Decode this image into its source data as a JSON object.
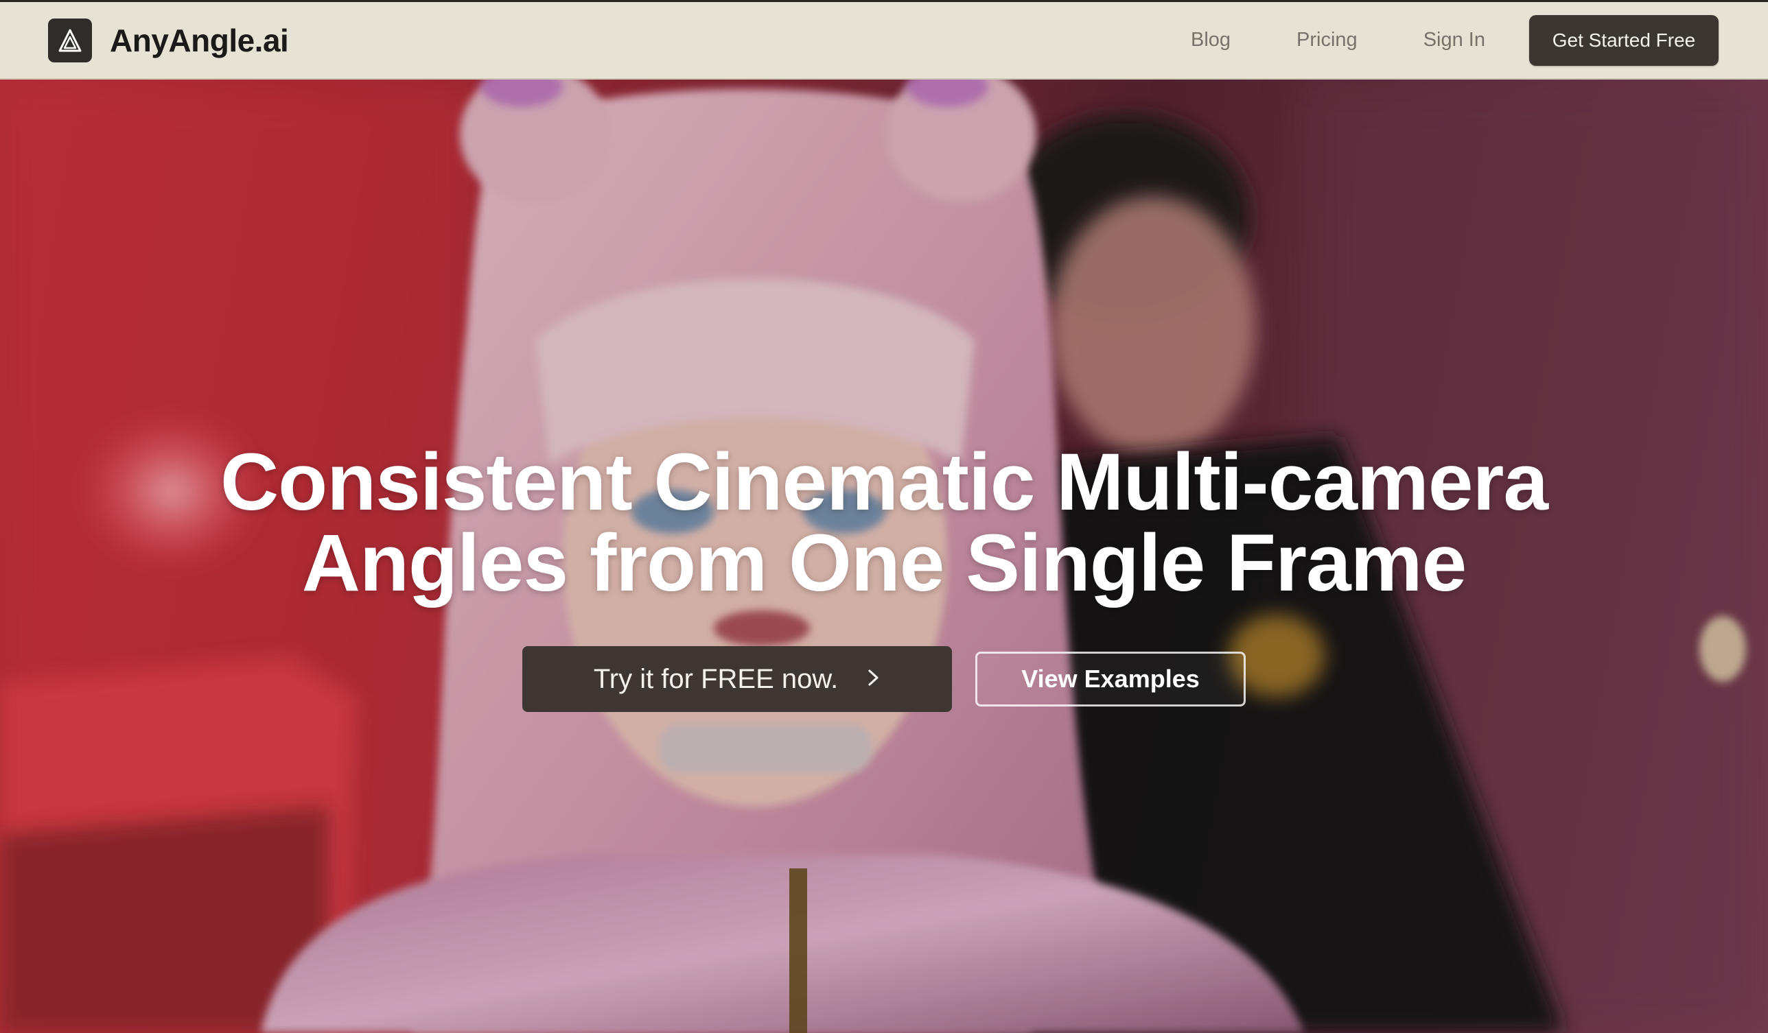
{
  "brand": {
    "name": "AnyAngle.ai",
    "logo_icon": "triangle-a-logo-icon"
  },
  "nav": {
    "links": [
      "Blog",
      "Pricing",
      "Sign In"
    ],
    "cta_label": "Get Started Free"
  },
  "hero": {
    "title_line1": "Consistent Cinematic Multi-camera",
    "title_line2": "Angles from One Single Frame",
    "primary_cta": "Try it for FREE now.",
    "primary_cta_icon": "chevron-right-icon",
    "secondary_cta": "View Examples"
  },
  "colors": {
    "nav_bg": "#e6e2d4",
    "button_dark": "#3b3632",
    "hero_red": "#c6323e"
  }
}
